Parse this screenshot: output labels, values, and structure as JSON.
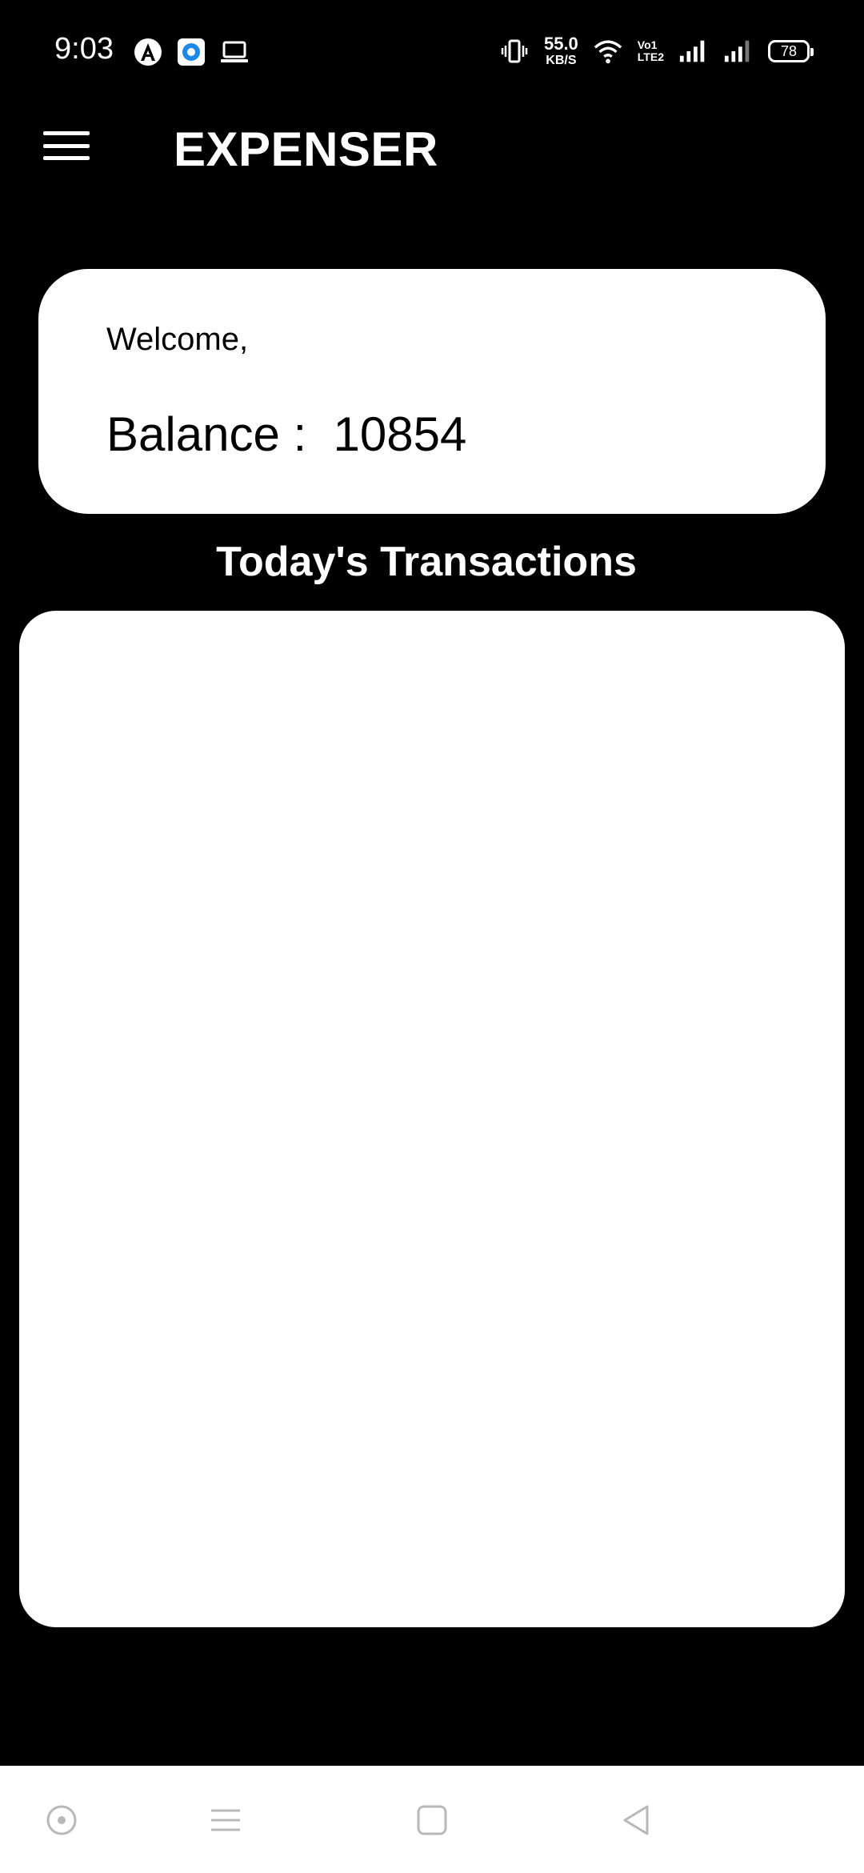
{
  "status_bar": {
    "time": "9:03",
    "net_speed_value": "55.0",
    "net_speed_unit": "KB/S",
    "volte_line1": "Vo1",
    "volte_line2": "LTE2",
    "battery_level": "78",
    "icons": [
      "app-a-icon",
      "app-blue-icon",
      "laptop-icon",
      "vibrate-icon",
      "wifi-icon",
      "signal-icon",
      "signal-icon",
      "battery-icon"
    ]
  },
  "app_bar": {
    "title": "EXPENSER",
    "menu_icon": "hamburger-menu-icon"
  },
  "balance_card": {
    "welcome": "Welcome,",
    "balance_label": "Balance :",
    "balance_value": "10854"
  },
  "transactions": {
    "title": "Today's Transactions",
    "items": []
  },
  "nav_bar": {
    "buttons": [
      "assistant-icon",
      "recents-icon",
      "home-icon",
      "back-icon"
    ]
  },
  "colors": {
    "background": "#000000",
    "card": "#ffffff",
    "text_dark": "#000000",
    "text_light": "#ffffff",
    "nav_icons": "#b8b8b8"
  }
}
